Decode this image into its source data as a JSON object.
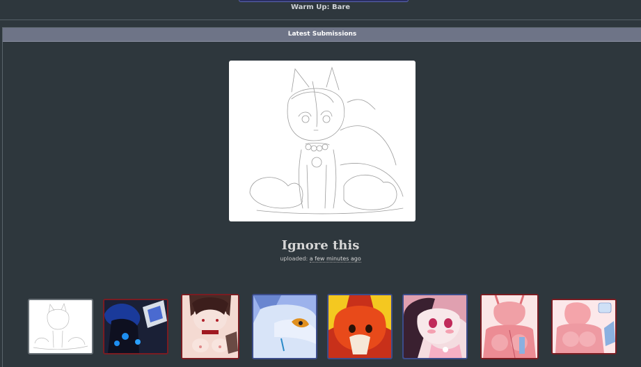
{
  "top": {
    "warmup_label": "Warm Up: Bare"
  },
  "panel": {
    "header": "Latest Submissions"
  },
  "featured": {
    "title": "Ignore this",
    "uploaded_label": "uploaded:",
    "uploaded_time": "a few minutes ago"
  },
  "thumbnails": [
    {
      "border": "#6a7278",
      "bg": "#ffffff"
    },
    {
      "border": "#7a1c22",
      "bg": "#1e2a4a"
    },
    {
      "border": "#7a1c22",
      "bg": "#f2d4cc"
    },
    {
      "border": "#3c4c8a",
      "bg": "#8aa2e0"
    },
    {
      "border": "#3c4c8a",
      "bg": "#e24a1e"
    },
    {
      "border": "#3c4c8a",
      "bg": "#f4d8dc"
    },
    {
      "border": "#7a1c22",
      "bg": "#f2a8ac"
    },
    {
      "border": "#7a1c22",
      "bg": "#f7c0c4"
    }
  ]
}
